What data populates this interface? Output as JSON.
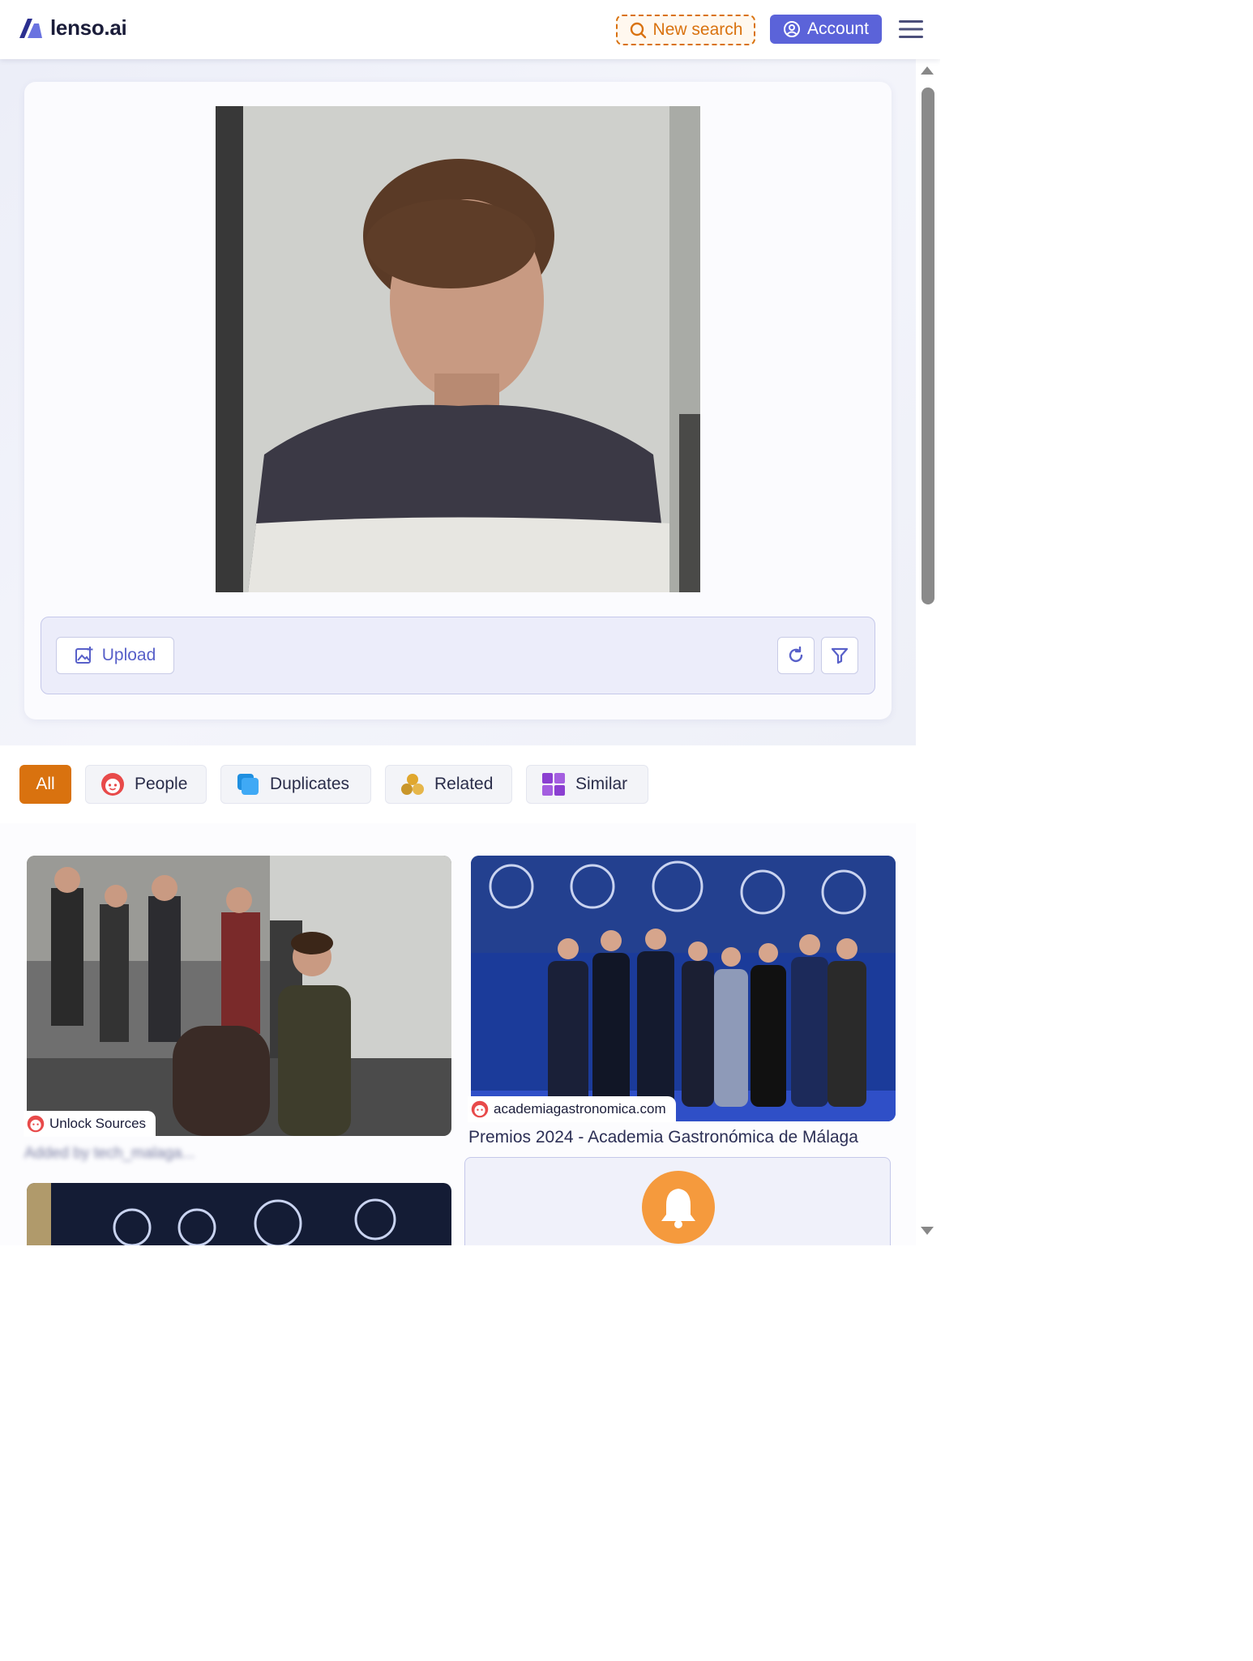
{
  "header": {
    "brand": "lenso.ai",
    "new_search_label": "New search",
    "account_label": "Account",
    "accent": "#5b63d9",
    "highlight": "#d9720f"
  },
  "toolbar": {
    "upload_label": "Upload",
    "refresh_icon": "refresh-icon",
    "filter_icon": "filter-icon"
  },
  "tabs": [
    {
      "label": "All",
      "active": true
    },
    {
      "label": "People",
      "icon": "face-icon"
    },
    {
      "label": "Duplicates",
      "icon": "duplicates-icon"
    },
    {
      "label": "Related",
      "icon": "related-icon"
    },
    {
      "label": "Similar",
      "icon": "similar-icon"
    }
  ],
  "results": [
    {
      "badge": "Unlock Sources",
      "caption": "Added by tech_malaga..."
    },
    {
      "badge": "academiagastronomica.com",
      "title": "Premios 2024 - Academia Gastronómica de Málaga"
    }
  ],
  "notify_icon": "bell-icon"
}
